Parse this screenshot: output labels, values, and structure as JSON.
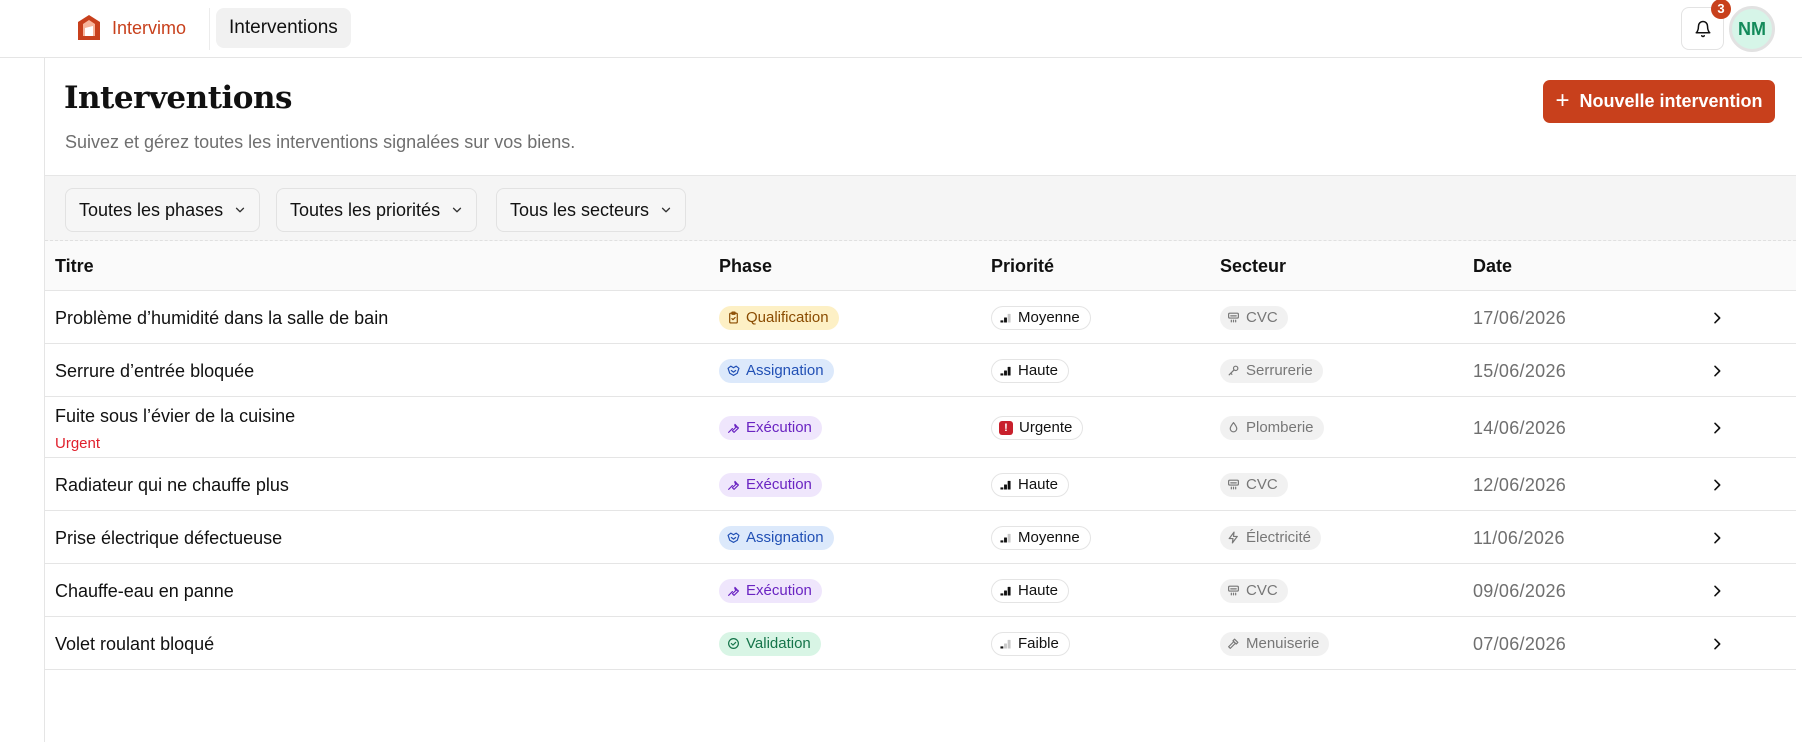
{
  "app": {
    "name": "Intervimo",
    "nav_tab": "Interventions"
  },
  "notifications": {
    "count": "3"
  },
  "user": {
    "initials": "NM"
  },
  "header": {
    "title": "Interventions",
    "subtitle": "Suivez et gérez toutes les interventions signalées sur vos biens.",
    "new_button": "Nouvelle intervention"
  },
  "filters": {
    "phases": "Toutes les phases",
    "priorities": "Toutes les priorités",
    "sectors": "Tous les secteurs"
  },
  "table": {
    "columns": [
      "Titre",
      "Phase",
      "Priorité",
      "Secteur",
      "Date"
    ],
    "rows": [
      {
        "title": "Problème d’humidité dans la salle de bain",
        "flag": "",
        "phase": "Qualification",
        "phase_icon": "clipboard-icon",
        "priority": "Moyenne",
        "priority_icon": "signal-medium-icon",
        "sector": "CVC",
        "sector_icon": "hvac-icon",
        "date": "17/06/2026"
      },
      {
        "title": "Serrure d’entrée bloquée",
        "flag": "",
        "phase": "Assignation",
        "phase_icon": "handshake-icon",
        "priority": "Haute",
        "priority_icon": "signal-high-icon",
        "sector": "Serrurerie",
        "sector_icon": "key-icon",
        "date": "15/06/2026"
      },
      {
        "title": "Fuite sous l’évier de la cuisine",
        "flag": "Urgent",
        "phase": "Exécution",
        "phase_icon": "wrench-icon",
        "priority": "Urgente",
        "priority_icon": "urgent-alert-icon",
        "sector": "Plomberie",
        "sector_icon": "droplet-icon",
        "date": "14/06/2026"
      },
      {
        "title": "Radiateur qui ne chauffe plus",
        "flag": "",
        "phase": "Exécution",
        "phase_icon": "wrench-icon",
        "priority": "Haute",
        "priority_icon": "signal-high-icon",
        "sector": "CVC",
        "sector_icon": "hvac-icon",
        "date": "12/06/2026"
      },
      {
        "title": "Prise électrique défectueuse",
        "flag": "",
        "phase": "Assignation",
        "phase_icon": "handshake-icon",
        "priority": "Moyenne",
        "priority_icon": "signal-medium-icon",
        "sector": "Électricité",
        "sector_icon": "lightning-icon",
        "date": "11/06/2026"
      },
      {
        "title": "Chauffe-eau en panne",
        "flag": "",
        "phase": "Exécution",
        "phase_icon": "wrench-icon",
        "priority": "Haute",
        "priority_icon": "signal-high-icon",
        "sector": "CVC",
        "sector_icon": "hvac-icon",
        "date": "09/06/2026"
      },
      {
        "title": "Volet roulant bloqué",
        "flag": "",
        "phase": "Validation",
        "phase_icon": "check-circle-icon",
        "priority": "Faible",
        "priority_icon": "signal-low-icon",
        "sector": "Menuiserie",
        "sector_icon": "hammer-icon",
        "date": "07/06/2026"
      }
    ]
  },
  "colors": {
    "brand": "#c8401c",
    "urgent": "#e0202c",
    "phase_qualification": "#fdf0c5",
    "phase_assignation": "#dce9fb",
    "phase_execution": "#efe6fc",
    "phase_validation": "#d8f5e5"
  }
}
